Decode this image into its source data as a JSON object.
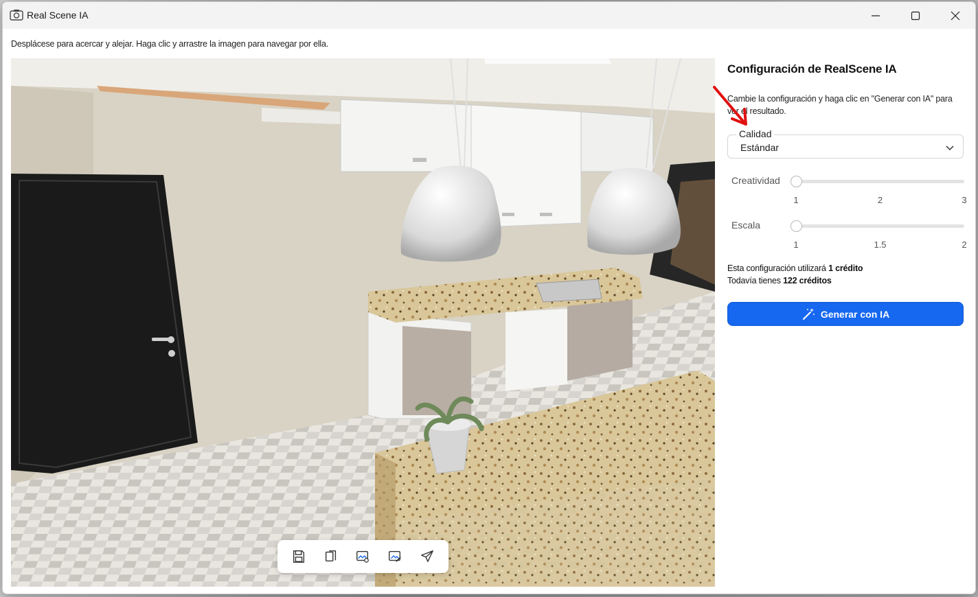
{
  "window": {
    "title": "Real Scene IA"
  },
  "hint_text": "Desplácese para acercar y alejar. Haga clic y arrastre la imagen para navegar por ella.",
  "panel": {
    "title": "Configuración de RealScene IA",
    "description": "Cambie la configuración y haga clic en \"Generar con IA\" para ver el resultado.",
    "quality": {
      "label": "Calidad",
      "value": "Estándar"
    },
    "creativity": {
      "label": "Creatividad",
      "min": 1,
      "max": 3,
      "value": 1,
      "ticks": [
        "1",
        "2",
        "3"
      ]
    },
    "scale": {
      "label": "Escala",
      "min": 1,
      "max": 2,
      "value": 1,
      "ticks": [
        "1",
        "1.5",
        "2"
      ]
    },
    "credits": {
      "line1_prefix": "Esta configuración utilizará ",
      "line1_bold": "1 crédito",
      "line2_prefix": "Todavía tienes ",
      "line2_bold": "122 créditos"
    },
    "generate_label": "Generar con IA"
  },
  "toolbar_icons": [
    "save-icon",
    "copy-icon",
    "image-settings-icon",
    "image-edit-icon",
    "send-icon"
  ],
  "colors": {
    "accent": "#1768f0",
    "annotation_arrow": "#e01010"
  }
}
